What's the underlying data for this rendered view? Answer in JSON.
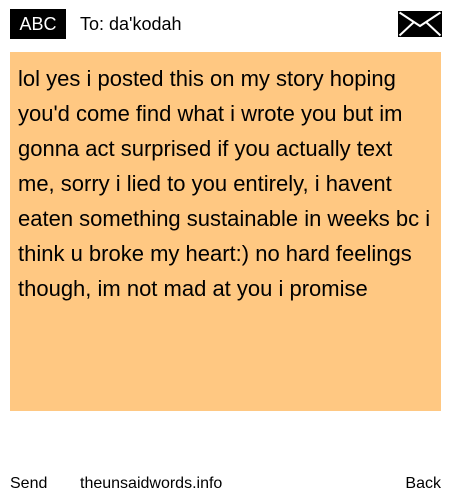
{
  "header": {
    "badge": "ABC",
    "to_prefix": "To:",
    "recipient": "da'kodah",
    "mail_icon": "envelope-icon"
  },
  "message": {
    "text": "lol yes i posted this on my story hoping you'd come find what i wrote you but im gonna act surprised if you actually text me, sorry i lied to you entirely, i havent eaten something sustainable in weeks bc i think u broke my heart:) no hard feelings though, im not mad at you i promise",
    "background_color": "#ffc882"
  },
  "footer": {
    "send_label": "Send",
    "site": "theunsaidwords.info",
    "back_label": "Back"
  }
}
